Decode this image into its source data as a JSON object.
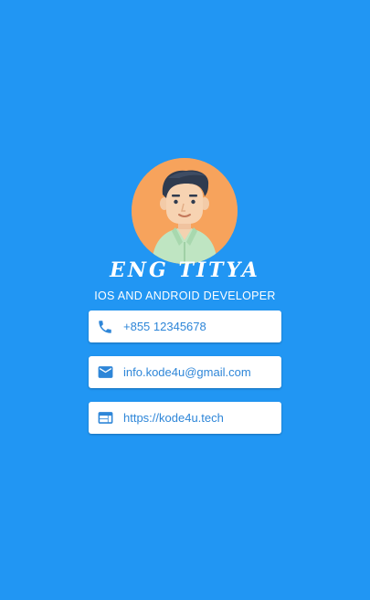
{
  "profile": {
    "name": "ENG TITYA",
    "role": "IOS AND ANDROID DEVELOPER"
  },
  "contacts": {
    "phone": "+855 12345678",
    "email": "info.kode4u@gmail.com",
    "website": "https://kode4u.tech"
  },
  "colors": {
    "background": "#2196F3",
    "accent": "#2E86D8",
    "avatar_bg": "#F7A35C",
    "card": "#FFFFFF"
  },
  "icons": {
    "phone": "phone-icon",
    "email": "mail-icon",
    "website": "web-icon"
  }
}
